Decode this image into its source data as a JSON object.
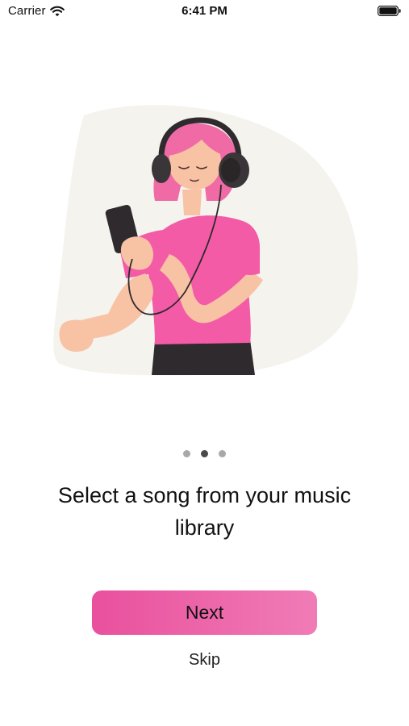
{
  "status_bar": {
    "carrier": "Carrier",
    "time": "6:41 PM",
    "wifi_icon": "wifi-icon",
    "battery_icon": "battery-full-icon"
  },
  "illustration": {
    "subject": "woman-with-headphones-holding-phone"
  },
  "pagination": {
    "count": 3,
    "active_index": 1
  },
  "onboarding": {
    "title": "Select a song from your music library",
    "next_label": "Next",
    "skip_label": "Skip"
  },
  "colors": {
    "accent_start": "#e9509d",
    "accent_end": "#f07cb6",
    "shirt": "#f35ba6",
    "hair": "#f06aa5",
    "blob": "#f5f3ee",
    "dot_inactive": "#a8a8a8",
    "dot_active": "#4a4a4a"
  }
}
